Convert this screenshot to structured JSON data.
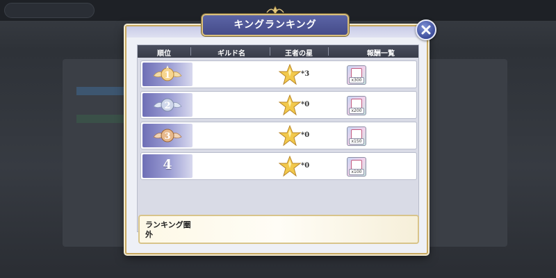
{
  "dialog": {
    "title": "キングランキング"
  },
  "columns": {
    "rank": "順位",
    "guild": "ギルド名",
    "stars": "王者の星",
    "rewards": "報酬一覧"
  },
  "rows": [
    {
      "rank": "1",
      "rank_style": "gold-emblem",
      "guild_name": "",
      "stars": "*3",
      "reward_quantity": "x300"
    },
    {
      "rank": "2",
      "rank_style": "silver-emblem",
      "guild_name": "",
      "stars": "*0",
      "reward_quantity": "x200"
    },
    {
      "rank": "3",
      "rank_style": "bronze-emblem",
      "guild_name": "",
      "stars": "*0",
      "reward_quantity": "x150"
    },
    {
      "rank": "4",
      "rank_style": "plain-number",
      "guild_name": "",
      "stars": "*0",
      "reward_quantity": "x100"
    }
  ],
  "my_rank": {
    "label": "ランキング圏外"
  },
  "colors": {
    "frame_gold": "#c7a860",
    "title_plate": "#454c8a",
    "header_bg": "#393d49",
    "rank_cell": "#6e6fb6"
  },
  "icons": {
    "close": "close-icon",
    "star": "gold-star-icon",
    "reward": "gift-box-icon"
  }
}
